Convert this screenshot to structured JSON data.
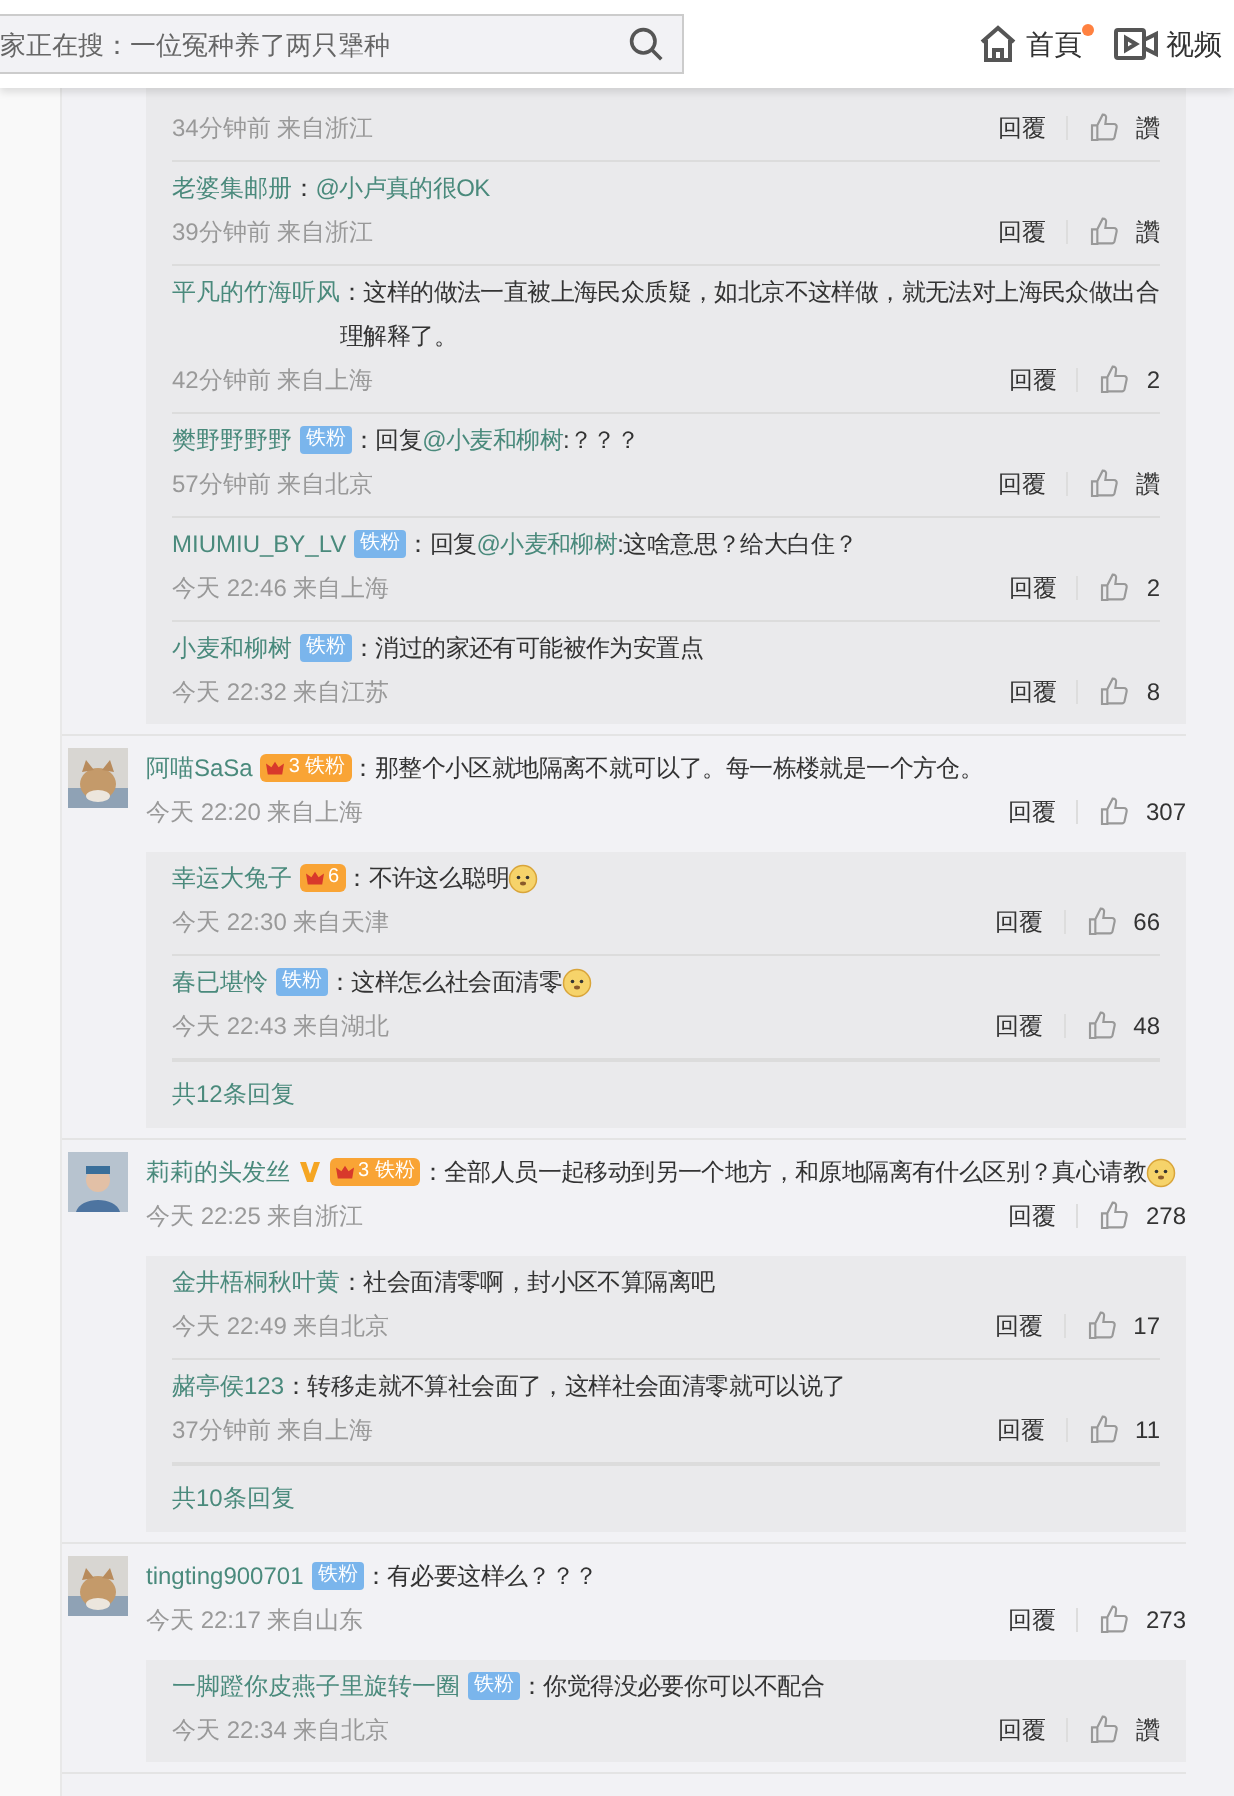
{
  "header": {
    "search": {
      "placeholder": "家正在搜：一位冤种养了两只犟种"
    },
    "nav": [
      {
        "label": "首頁",
        "dot": true
      },
      {
        "label": "视频",
        "dot": false
      }
    ]
  },
  "groups": [
    {
      "replies": [
        {
          "time": "34分钟前",
          "location": "来自浙江",
          "reply": "回覆",
          "likes": "讚"
        },
        {
          "author": "老婆集邮册",
          "content": [
            {
              "kind": "plain",
              "text": "："
            },
            {
              "kind": "mention",
              "text": "@小卢真的很OK"
            }
          ],
          "time": "39分钟前",
          "location": "来自浙江",
          "reply": "回覆",
          "likes": "讚"
        },
        {
          "author": "平凡的竹海听风",
          "content": [
            {
              "kind": "plain",
              "text": "：这样的做法一直被上海民众质疑，如北京不这样做，就无法对上海民众做出合理解释了。"
            }
          ],
          "time": "42分钟前",
          "location": "来自上海",
          "reply": "回覆",
          "likes": "2"
        },
        {
          "author": "樊野野野野",
          "badges": [
            {
              "kind": "fan",
              "label": "铁粉"
            }
          ],
          "content": [
            {
              "kind": "plain",
              "text": "：回复"
            },
            {
              "kind": "mention",
              "text": "@小麦和柳树"
            },
            {
              "kind": "plain",
              "text": ":？？？"
            }
          ],
          "time": "57分钟前",
          "location": "来自北京",
          "reply": "回覆",
          "likes": "讚"
        },
        {
          "author": "MIUMIU_BY_LV",
          "badges": [
            {
              "kind": "fan",
              "label": "铁粉"
            }
          ],
          "content": [
            {
              "kind": "plain",
              "text": "：回复"
            },
            {
              "kind": "mention",
              "text": "@小麦和柳树"
            },
            {
              "kind": "plain",
              "text": ":这啥意思？给大白住？"
            }
          ],
          "time": "今天 22:46",
          "location": "来自上海",
          "reply": "回覆",
          "likes": "2"
        },
        {
          "author": "小麦和柳树",
          "badges": [
            {
              "kind": "fan",
              "label": "铁粉"
            }
          ],
          "content": [
            {
              "kind": "plain",
              "text": "：消过的家还有可能被作为安置点"
            }
          ],
          "time": "今天 22:32",
          "location": "来自江苏",
          "reply": "回覆",
          "likes": "8"
        }
      ]
    },
    {
      "comment": {
        "author": "阿喵SaSa",
        "badges": [
          {
            "kind": "crown",
            "level": "3",
            "label": "铁粉"
          }
        ],
        "content": [
          {
            "kind": "plain",
            "text": "：那整个小区就地隔离不就可以了。每一栋楼就是一个方仓。"
          }
        ],
        "emoji": false,
        "time": "今天 22:20",
        "location": "来自上海",
        "reply": "回覆",
        "likes": "307"
      },
      "replies": [
        {
          "author": "幸运大兔子",
          "badges": [
            {
              "kind": "crown",
              "level": "6"
            }
          ],
          "content": [
            {
              "kind": "plain",
              "text": "：不许这么聪明"
            }
          ],
          "emoji": true,
          "time": "今天 22:30",
          "location": "来自天津",
          "reply": "回覆",
          "likes": "66"
        },
        {
          "author": "春已堪怜",
          "badges": [
            {
              "kind": "fan",
              "label": "铁粉"
            }
          ],
          "content": [
            {
              "kind": "plain",
              "text": "：这样怎么社会面清零"
            }
          ],
          "emoji": true,
          "time": "今天 22:43",
          "location": "来自湖北",
          "reply": "回覆",
          "likes": "48"
        }
      ],
      "more": "共12条回复"
    },
    {
      "comment": {
        "author": "莉莉的头发丝",
        "badges": [
          {
            "kind": "verified"
          },
          {
            "kind": "crown",
            "level": "3",
            "label": "铁粉"
          }
        ],
        "content": [
          {
            "kind": "plain",
            "text": "：全部人员一起移动到另一个地方，和原地隔离有什么区别？真心请教"
          }
        ],
        "emoji": true,
        "time": "今天 22:25",
        "location": "来自浙江",
        "reply": "回覆",
        "likes": "278"
      },
      "replies": [
        {
          "author": "金井梧桐秋叶黄",
          "content": [
            {
              "kind": "plain",
              "text": "：社会面清零啊，封小区不算隔离吧"
            }
          ],
          "time": "今天 22:49",
          "location": "来自北京",
          "reply": "回覆",
          "likes": "17"
        },
        {
          "author": "赭亭侯123",
          "content": [
            {
              "kind": "plain",
              "text": "：转移走就不算社会面了，这样社会面清零就可以说了"
            }
          ],
          "time": "37分钟前",
          "location": "来自上海",
          "reply": "回覆",
          "likes": "11"
        }
      ],
      "more": "共10条回复"
    },
    {
      "comment": {
        "author": "tingting900701",
        "badges": [
          {
            "kind": "fan",
            "label": "铁粉"
          }
        ],
        "content": [
          {
            "kind": "plain",
            "text": "：有必要这样么？？？"
          }
        ],
        "emoji": false,
        "time": "今天 22:17",
        "location": "来自山东",
        "reply": "回覆",
        "likes": "273"
      },
      "replies": [
        {
          "author": "一脚蹬你皮燕子里旋转一圈",
          "badges": [
            {
              "kind": "fan",
              "label": "铁粉"
            }
          ],
          "content": [
            {
              "kind": "plain",
              "text": "：你觉得没必要你可以不配合"
            }
          ],
          "time": "今天 22:34",
          "location": "来自北京",
          "reply": "回覆",
          "likes": "讚"
        }
      ]
    }
  ]
}
